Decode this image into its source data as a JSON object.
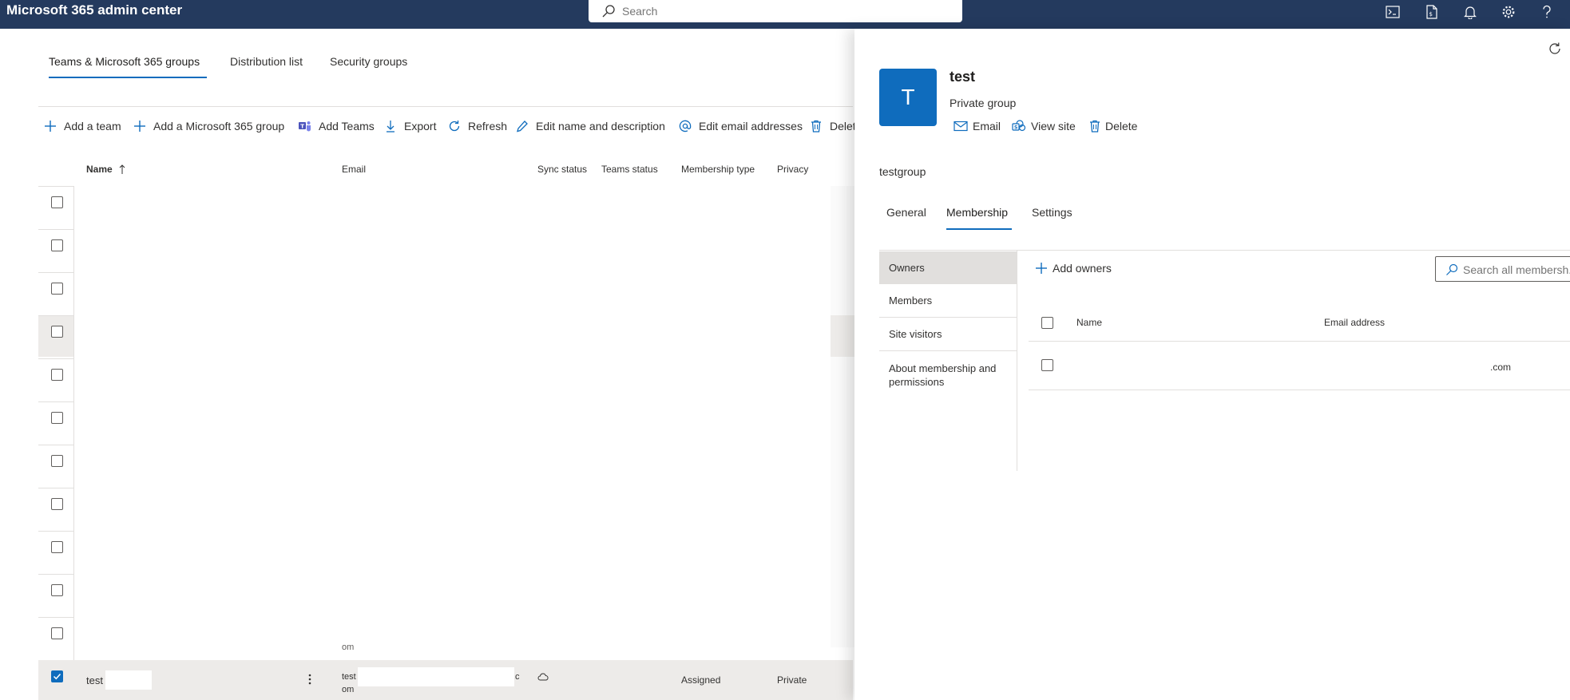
{
  "app": {
    "title": "Microsoft 365 admin center"
  },
  "search": {
    "placeholder": "Search"
  },
  "tabs": [
    {
      "label": "Teams & Microsoft 365 groups",
      "active": true
    },
    {
      "label": "Distribution list"
    },
    {
      "label": "Security groups"
    }
  ],
  "commands": [
    {
      "label": "Add a team",
      "icon": "plus-icon"
    },
    {
      "label": "Add a Microsoft 365 group",
      "icon": "plus-icon"
    },
    {
      "label": "Add Teams",
      "icon": "teams-icon"
    },
    {
      "label": "Export",
      "icon": "download-icon"
    },
    {
      "label": "Refresh",
      "icon": "refresh-icon"
    },
    {
      "label": "Edit name and description",
      "icon": "pencil-icon"
    },
    {
      "label": "Edit email addresses",
      "icon": "at-icon"
    },
    {
      "label": "Delet",
      "icon": "trash-icon"
    }
  ],
  "columns": {
    "name": "Name",
    "email": "Email",
    "sync_status": "Sync status",
    "teams_status": "Teams status",
    "membership_type": "Membership type",
    "privacy": "Privacy"
  },
  "selected_row": {
    "name": "test",
    "email_line1": "test",
    "email_suffix": ".c",
    "email_line2": "om",
    "partial_text": "om",
    "membership_type": "Assigned",
    "privacy": "Private"
  },
  "panel": {
    "avatar_letter": "T",
    "group_name": "test",
    "group_type": "Private group",
    "actions": [
      {
        "label": "Email",
        "icon": "mail-icon"
      },
      {
        "label": "View site",
        "icon": "sharepoint-icon"
      },
      {
        "label": "Delete",
        "icon": "trash-icon"
      }
    ],
    "email_alias": "testgroup",
    "tabs": [
      {
        "label": "General"
      },
      {
        "label": "Membership",
        "active": true
      },
      {
        "label": "Settings"
      }
    ],
    "subnav": [
      {
        "label": "Owners",
        "active": true
      },
      {
        "label": "Members"
      },
      {
        "label": "Site visitors"
      },
      {
        "label": "About membership and permissions"
      }
    ],
    "add_owners_label": "Add owners",
    "search_placeholder": "Search all membersh...",
    "columns": {
      "name": "Name",
      "email": "Email address"
    },
    "row": {
      "email_suffix": ".com"
    }
  },
  "colors": {
    "topbar": "#243a5e",
    "accent": "#0f6cbd"
  }
}
